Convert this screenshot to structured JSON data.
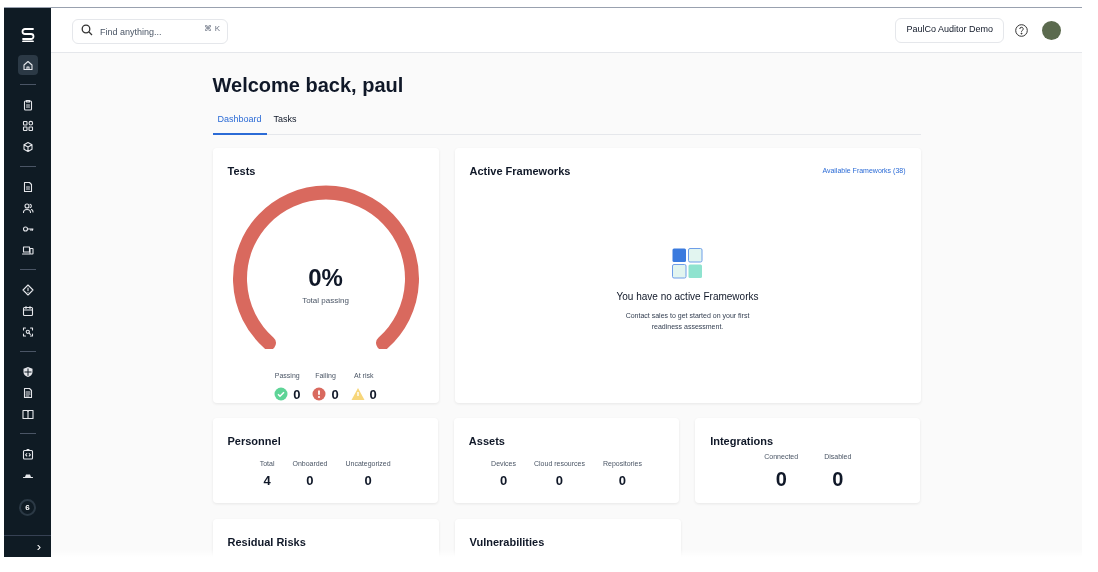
{
  "sidebar": {
    "groups": [
      [
        {
          "selected": true
        }
      ],
      [
        {
          "selected": false
        },
        {
          "selected": false
        },
        {
          "selected": false
        }
      ],
      [
        {
          "selected": false
        },
        {
          "selected": false
        },
        {
          "selected": false
        },
        {
          "selected": false
        }
      ],
      [
        {
          "selected": false
        },
        {
          "selected": false
        },
        {
          "selected": false
        }
      ],
      [
        {
          "selected": false
        },
        {
          "selected": false
        },
        {
          "selected": false
        }
      ],
      [
        {
          "selected": false
        },
        {
          "selected": false
        }
      ]
    ],
    "badge": "6",
    "collapse": "›"
  },
  "topbar": {
    "search": {
      "placeholder": "Find anything...",
      "shortcut": "⌘ K"
    },
    "org_button": "PaulCo Auditor Demo"
  },
  "heading": "Welcome back, paul",
  "tabs": [
    {
      "label": "Dashboard",
      "selected": true
    },
    {
      "label": "Tasks",
      "selected": false
    }
  ],
  "tests": {
    "title": "Tests",
    "percent": "0%",
    "caption": "Total passing",
    "stats": [
      {
        "kind": "passing",
        "label": "Passing",
        "value": "0"
      },
      {
        "kind": "failing",
        "label": "Failing",
        "value": "0"
      },
      {
        "kind": "risk",
        "label": "At risk",
        "value": "0"
      }
    ]
  },
  "frameworks": {
    "title": "Active Frameworks",
    "link": "Available Frameworks (38)",
    "empty_title": "You have no active Frameworks",
    "empty_text": "Contact sales to get started on your first readiness assessment."
  },
  "summary_cards": [
    {
      "title": "Personnel",
      "kind": "compact",
      "stats": [
        {
          "label": "Total",
          "value": "4"
        },
        {
          "label": "Onboarded",
          "value": "0"
        },
        {
          "label": "Uncategorized",
          "value": "0"
        }
      ]
    },
    {
      "title": "Assets",
      "kind": "compact",
      "stats": [
        {
          "label": "Devices",
          "value": "0"
        },
        {
          "label": "Cloud resources",
          "value": "0"
        },
        {
          "label": "Repositories",
          "value": "0"
        }
      ]
    },
    {
      "title": "Integrations",
      "kind": "large",
      "stats": [
        {
          "label": "Connected",
          "value": "0"
        },
        {
          "label": "Disabled",
          "value": "0"
        }
      ]
    }
  ],
  "lower_cards": [
    {
      "title": "Residual Risks"
    },
    {
      "title": "Vulnerabilities"
    }
  ]
}
